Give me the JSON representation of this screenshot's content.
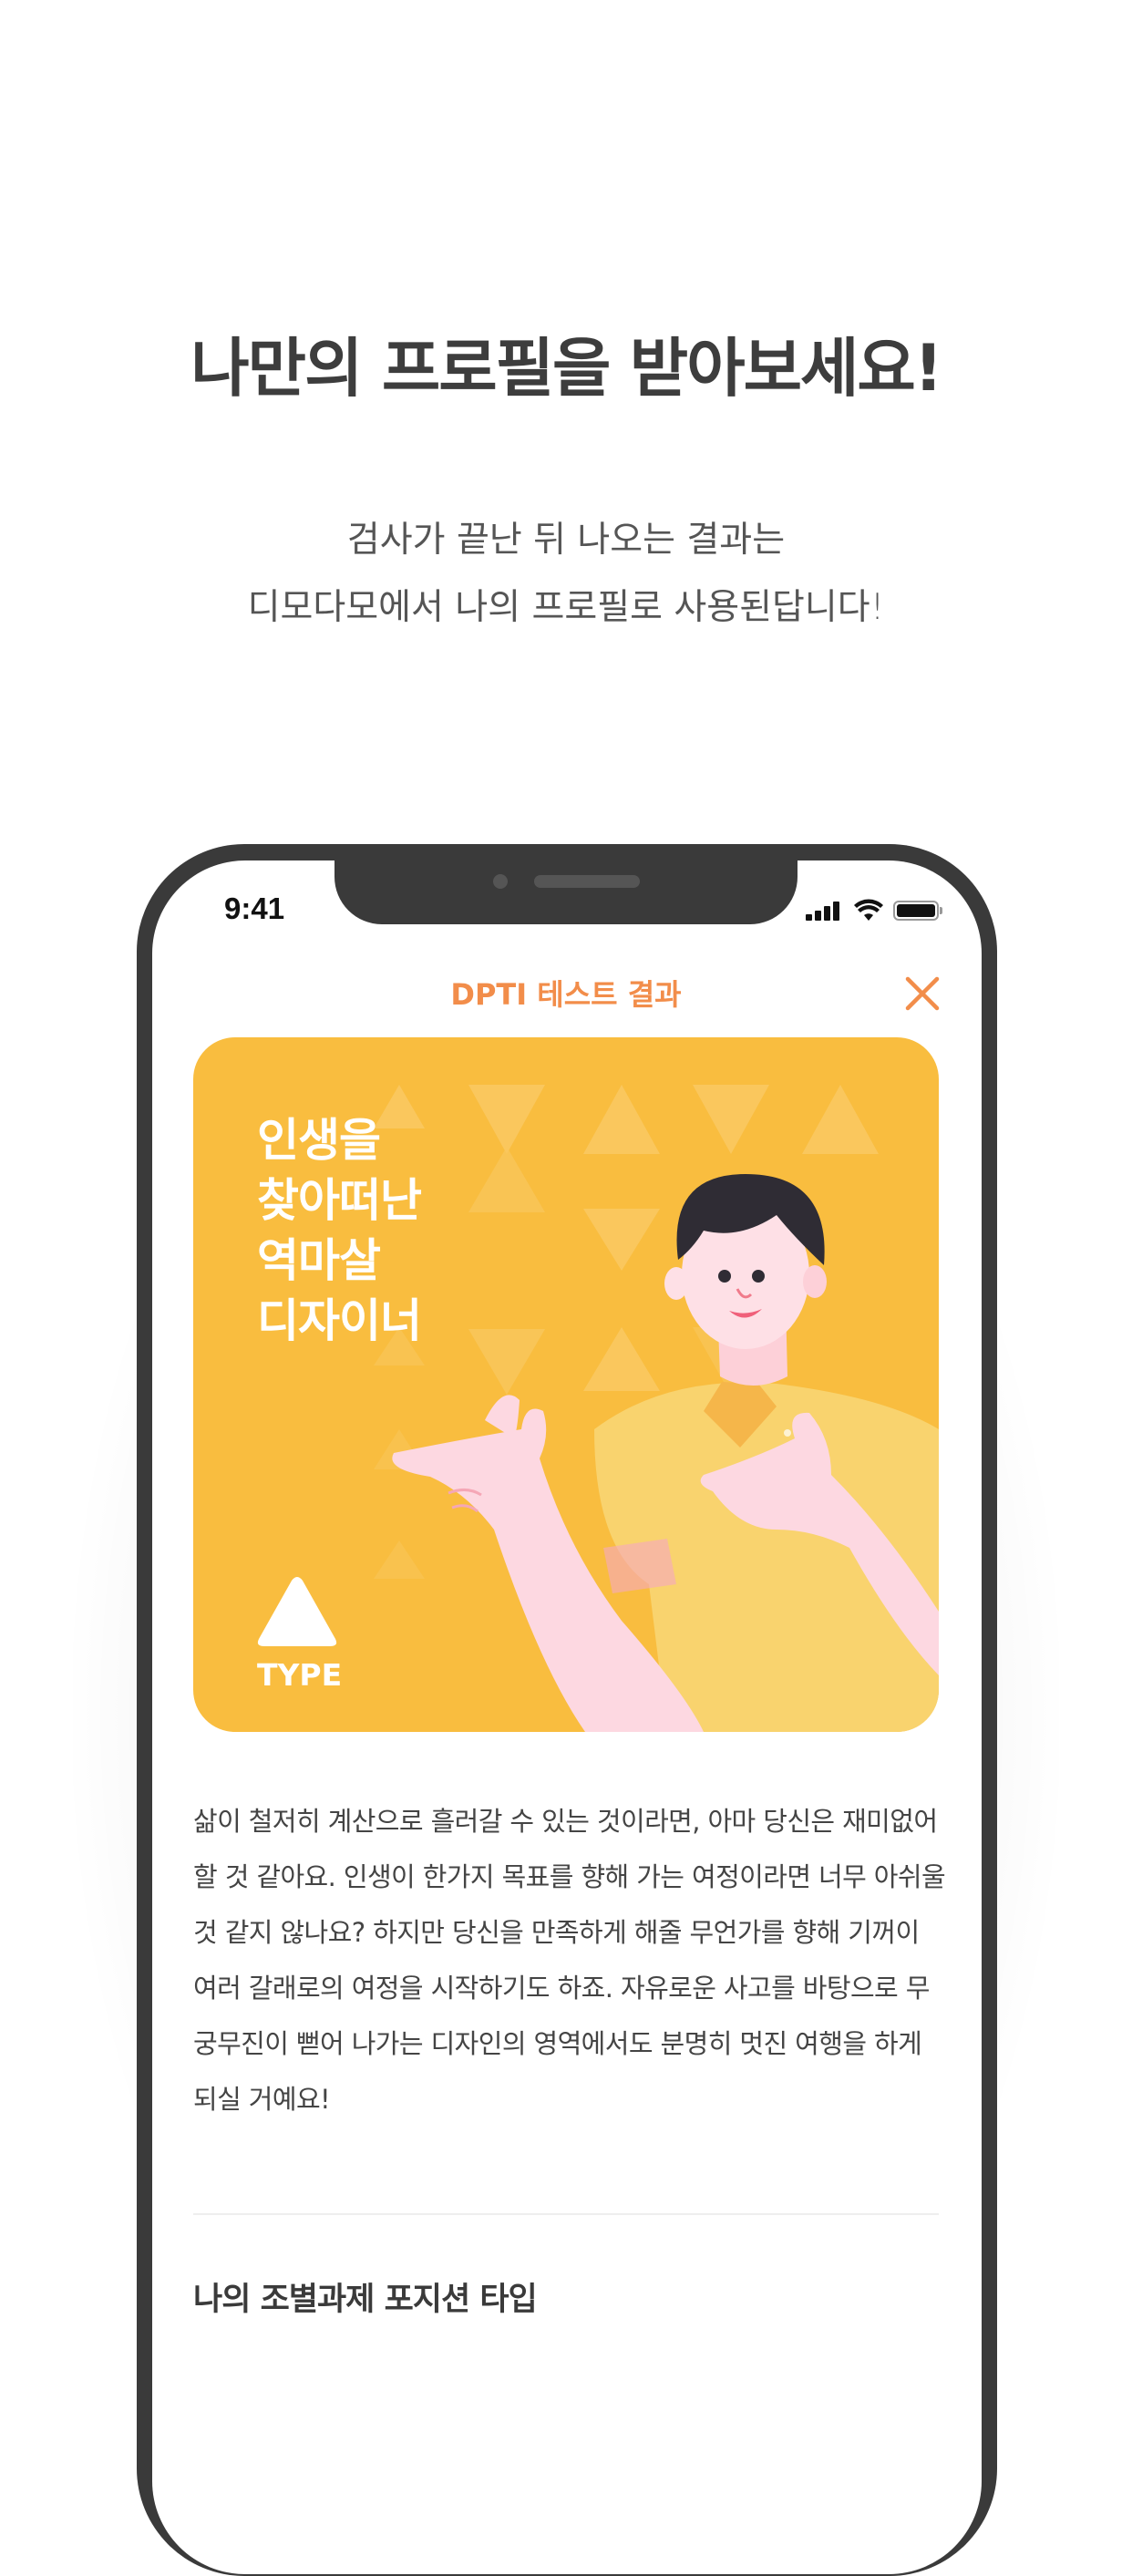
{
  "headline": "나만의 프로필을 받아보세요!",
  "subtext": {
    "line1": "검사가 끝난 뒤 나오는 결과는",
    "line2": "디모다모에서 나의 프로필로 사용된답니다!"
  },
  "status_bar": {
    "time": "9:41",
    "icons": [
      "signal-icon",
      "wifi-icon",
      "battery-icon"
    ]
  },
  "nav": {
    "title": "DPTI 테스트 결과",
    "close_icon": "close-icon"
  },
  "card": {
    "title_lines": [
      "인생을",
      "찾아떠난",
      "역마살",
      "디자이너"
    ],
    "type_label": "TYPE",
    "background_color": "#f9bd3f"
  },
  "description": {
    "lines": [
      "삶이 철저히 계산으로 흘러갈 수 있는 것이라면, 아마 당신은 재미없어",
      "할 것 같아요. 인생이 한가지 목표를 향해 가는 여정이라면 너무 아쉬울",
      "것 같지 않나요? 하지만 당신을 만족하게 해줄 무언가를 향해 기꺼이",
      "여러 갈래로의 여정을 시작하기도 하죠. 자유로운 사고를 바탕으로 무",
      "궁무진이 뻗어 나가는 디자인의 영역에서도 분명히 멋진 여행을 하게",
      "되실 거예요!"
    ]
  },
  "section": {
    "title": "나의 조별과제 포지션 타입"
  },
  "colors": {
    "accent": "#f28d4a",
    "card": "#f9bd3f",
    "phone_frame": "#3a3a3a"
  }
}
